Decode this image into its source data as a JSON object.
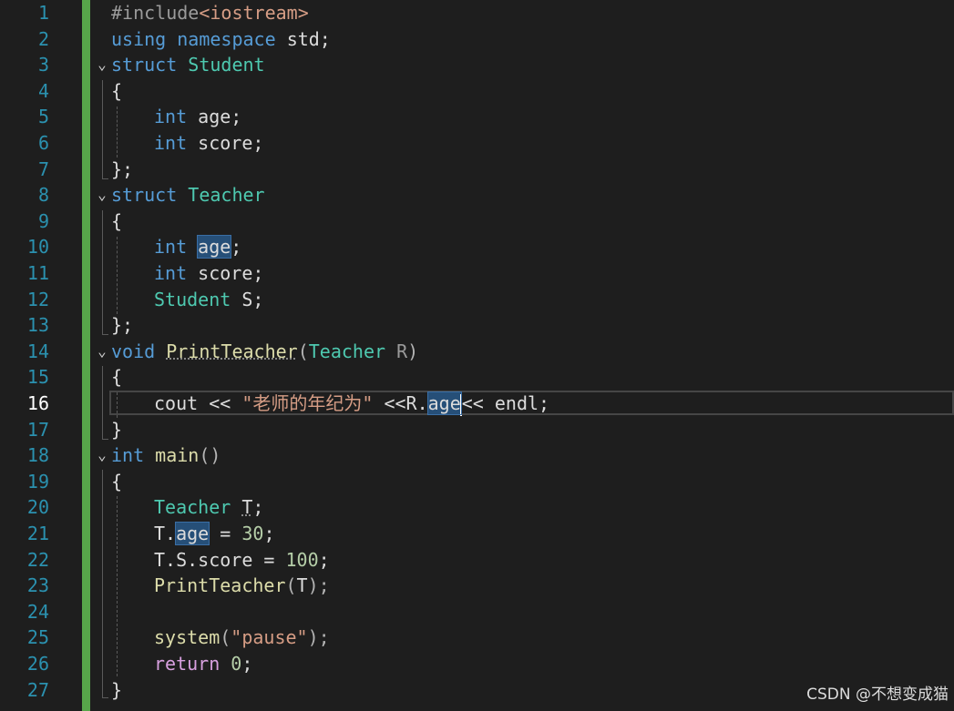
{
  "lines": [
    {
      "n": "1"
    },
    {
      "n": "2"
    },
    {
      "n": "3"
    },
    {
      "n": "4"
    },
    {
      "n": "5"
    },
    {
      "n": "6"
    },
    {
      "n": "7"
    },
    {
      "n": "8"
    },
    {
      "n": "9"
    },
    {
      "n": "10"
    },
    {
      "n": "11"
    },
    {
      "n": "12"
    },
    {
      "n": "13"
    },
    {
      "n": "14"
    },
    {
      "n": "15"
    },
    {
      "n": "16"
    },
    {
      "n": "17"
    },
    {
      "n": "18"
    },
    {
      "n": "19"
    },
    {
      "n": "20"
    },
    {
      "n": "21"
    },
    {
      "n": "22"
    },
    {
      "n": "23"
    },
    {
      "n": "24"
    },
    {
      "n": "25"
    },
    {
      "n": "26"
    },
    {
      "n": "27"
    }
  ],
  "active_line": "16",
  "code": {
    "l1": {
      "hash": "#include",
      "inc": "<iostream>"
    },
    "l2": {
      "using": "using",
      "namespace": "namespace",
      "std": "std;"
    },
    "l3": {
      "kw": "struct",
      "name": "Student"
    },
    "l4": {
      "brace": "{"
    },
    "l5": {
      "kw": "int",
      "rest": "age;"
    },
    "l6": {
      "kw": "int",
      "rest": "score;"
    },
    "l7": {
      "close": "};"
    },
    "l8": {
      "kw": "struct",
      "name": "Teacher"
    },
    "l9": {
      "brace": "{"
    },
    "l10": {
      "kw": "int",
      "var": "age",
      "rest": ";"
    },
    "l11": {
      "kw": "int",
      "rest": "score;"
    },
    "l12": {
      "type": "Student",
      "rest": "S;"
    },
    "l13": {
      "close": "};"
    },
    "l14": {
      "kw": "void",
      "fn": "PrintTeacher",
      "open": "(",
      "type": "Teacher",
      "param": "R",
      "close": ")"
    },
    "l15": {
      "brace": "{"
    },
    "l16": {
      "cout": "cout << ",
      "str": "\"老师的年纪为\"",
      "mid": " <<R.",
      "var": "age",
      "end": "<< endl;"
    },
    "l17": {
      "brace": "}"
    },
    "l18": {
      "kw": "int",
      "fn": "main",
      "paren": "()"
    },
    "l19": {
      "brace": "{"
    },
    "l20": {
      "type": "Teacher",
      "var": "T",
      "end": ";"
    },
    "l21": {
      "pre": "T.",
      "var": "age",
      "mid": " = ",
      "num": "30",
      "end": ";"
    },
    "l22": {
      "pre": "T.S.score = ",
      "num": "100",
      "end": ";"
    },
    "l23": {
      "fn": "PrintTeacher",
      "open": "(",
      "arg": "T",
      "close": ");"
    },
    "l24": {},
    "l25": {
      "fn": "system",
      "open": "(",
      "str": "\"pause\"",
      "close": ");"
    },
    "l26": {
      "kw": "return",
      "mid": " ",
      "num": "0",
      "end": ";"
    },
    "l27": {
      "brace": "}"
    }
  },
  "watermark": "CSDN @不想变成猫",
  "colors": {
    "background": "#1e1e1e",
    "change_bar": "#57a64a",
    "keyword": "#569cd6",
    "type": "#4ec9b0",
    "function": "#dcdcaa",
    "string": "#d69d85",
    "number": "#b5cea8",
    "selection": "#264f78"
  },
  "icons": {
    "fold": "chevron-down-icon"
  }
}
